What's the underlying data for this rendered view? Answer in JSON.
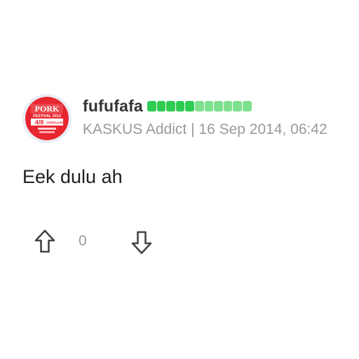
{
  "post": {
    "username": "fufufafa",
    "reputation_dots": {
      "total": 11,
      "filled": 5,
      "filled_color": "#2ecc52",
      "empty_color": "#7ee08e"
    },
    "user_title": "KASKUS Addict",
    "separator": "|",
    "date": "16 Sep 2014, 06:42",
    "content": "Eek dulu ah",
    "vote_count": "0",
    "avatar": {
      "lines": [
        "PORK",
        "FESTIVAL 2013",
        "4/8",
        "FEBRUARI"
      ],
      "bg_color": "#e8262f",
      "text_color": "#ffffff"
    },
    "icons": {
      "upvote": "arrow-up-outline-icon",
      "downvote": "arrow-down-outline-icon"
    }
  }
}
